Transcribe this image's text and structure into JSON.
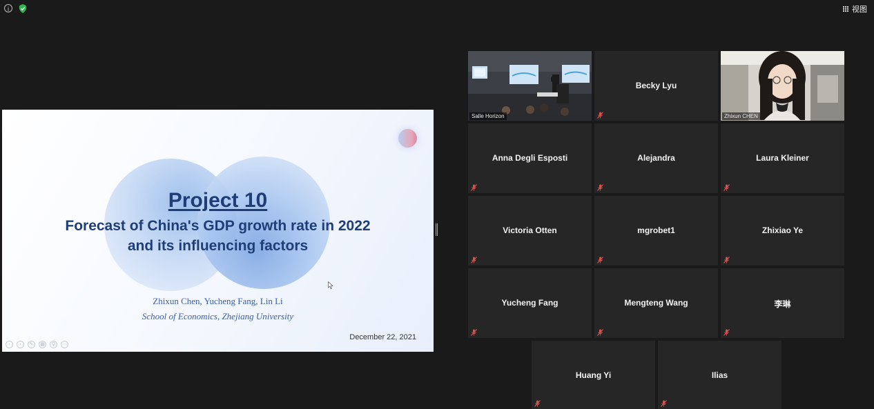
{
  "toolbar": {
    "view_label": "视图"
  },
  "slide": {
    "title": "Project 10",
    "subtitle_line1": "Forecast of China's GDP growth rate in 2022",
    "subtitle_line2": "and its influencing factors",
    "authors": "Zhixun Chen, Yucheng Fang, Lin Li",
    "affiliation": "School of Economics, Zhejiang University",
    "date": "December 22, 2021"
  },
  "participants": [
    {
      "name": "Salle Horizon",
      "video": true
    },
    {
      "name": "Becky Lyu",
      "video": false,
      "muted": true
    },
    {
      "name": "Zhixun  CHEN",
      "video": true,
      "active_speaker": true
    },
    {
      "name": "Anna Degli Esposti",
      "video": false,
      "muted": true
    },
    {
      "name": "Alejandra",
      "video": false,
      "muted": true
    },
    {
      "name": "Laura Kleiner",
      "video": false,
      "muted": true
    },
    {
      "name": "Victoria Otten",
      "video": false,
      "muted": true
    },
    {
      "name": "mgrobet1",
      "video": false,
      "muted": true
    },
    {
      "name": "Zhixiao Ye",
      "video": false,
      "muted": true
    },
    {
      "name": "Yucheng Fang",
      "video": false,
      "muted": true
    },
    {
      "name": "Mengteng Wang",
      "video": false,
      "muted": true
    },
    {
      "name": "李琳",
      "video": false,
      "muted": true
    },
    {
      "name": "Huang Yi",
      "video": false,
      "muted": true
    },
    {
      "name": "Ilias",
      "video": false,
      "muted": true
    }
  ],
  "colors": {
    "background": "#1a1a1a",
    "tile": "#262626",
    "active_speaker_border": "#c9dc5a",
    "muted_mic": "#d9534f"
  }
}
